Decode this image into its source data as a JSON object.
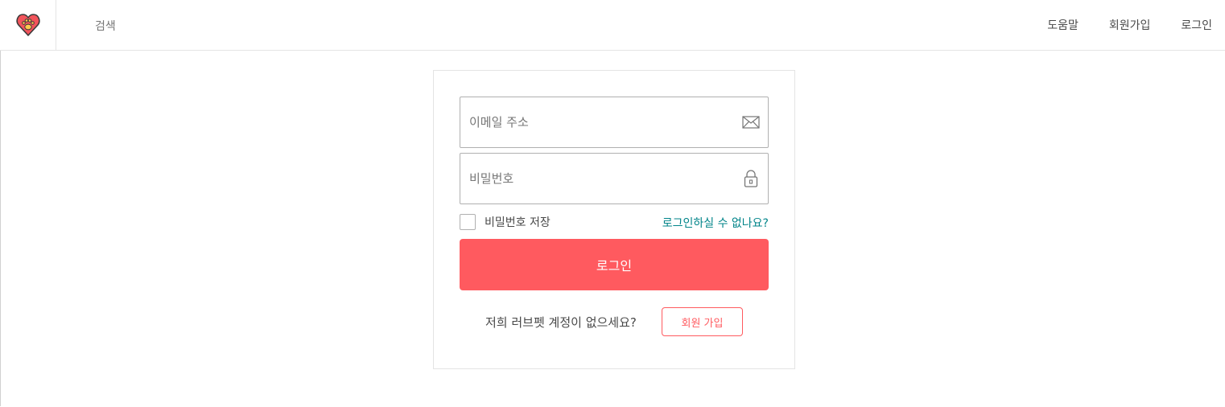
{
  "header": {
    "search_label": "검색",
    "nav": [
      {
        "label": "도움말"
      },
      {
        "label": "회원가입"
      },
      {
        "label": "로그인"
      }
    ]
  },
  "login_form": {
    "email_placeholder": "이메일 주소",
    "password_placeholder": "비밀번호",
    "remember_label": "비밀번호 저장",
    "forgot_link": "로그인하실 수 없나요?",
    "submit_label": "로그인",
    "signup_prompt": "저희 러브펫 계정이 없으세요?",
    "signup_button": "회원 가입"
  },
  "icons": {
    "logo": "heart-paw-icon",
    "email": "envelope-icon",
    "password": "lock-icon"
  },
  "colors": {
    "brand": "#ff5a5f",
    "link": "#008489",
    "text": "#484848",
    "muted": "#767676"
  }
}
